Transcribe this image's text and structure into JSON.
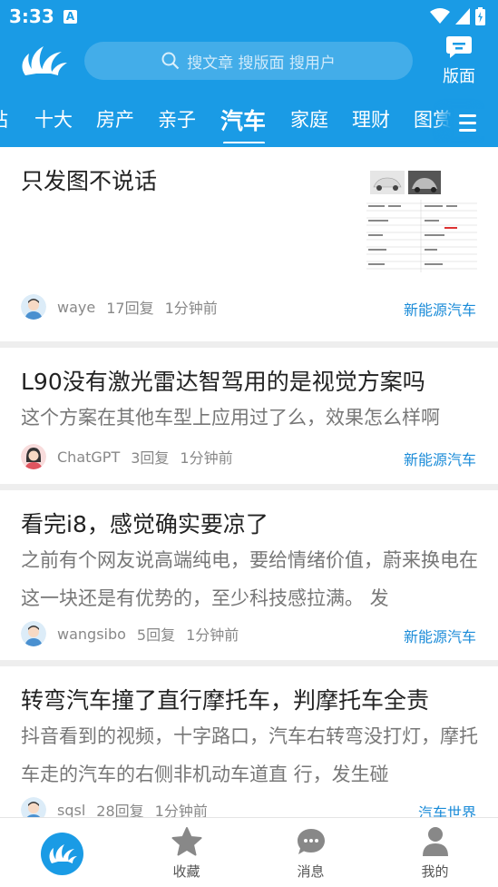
{
  "status": {
    "time": "3:33",
    "indicator": "A"
  },
  "header": {
    "search_placeholder": "搜文章 搜版面 搜用户",
    "board_button_label": "版面"
  },
  "tabs": [
    {
      "label": "站"
    },
    {
      "label": "十大"
    },
    {
      "label": "房产"
    },
    {
      "label": "亲子"
    },
    {
      "label": "汽车",
      "active": true
    },
    {
      "label": "家庭"
    },
    {
      "label": "理财"
    },
    {
      "label": "图赏"
    }
  ],
  "posts": [
    {
      "title": "只发图不说话",
      "excerpt": "",
      "author": "waye",
      "replies": "17回复",
      "time": "1分钟前",
      "board": "新能源汽车",
      "avatar": "male"
    },
    {
      "title": "L90没有激光雷达智驾用的是视觉方案吗",
      "excerpt": "这个方案在其他车型上应用过了么，效果怎么样啊",
      "author": "ChatGPT",
      "replies": "3回复",
      "time": "1分钟前",
      "board": "新能源汽车",
      "avatar": "female"
    },
    {
      "title": "看完i8，感觉确实要凉了",
      "excerpt": "之前有个网友说高端纯电，要给情绪价值，蔚来换电在这一块还是有优势的，至少科技感拉满。 发",
      "author": "wangsibo",
      "replies": "5回复",
      "time": "1分钟前",
      "board": "新能源汽车",
      "avatar": "male"
    },
    {
      "title": "转弯汽车撞了直行摩托车，判摩托车全责",
      "excerpt": "抖音看到的视频，十字路口，汽车右转弯没打灯，摩托车走的汽车的右侧非机动车道直 行，发生碰",
      "author": "sqsl",
      "replies": "28回复",
      "time": "1分钟前",
      "board": "汽车世界",
      "avatar": "male"
    }
  ],
  "bottom_nav": [
    {
      "label": "",
      "icon": "home-logo-icon"
    },
    {
      "label": "收藏",
      "icon": "star-icon"
    },
    {
      "label": "消息",
      "icon": "chat-bubble-icon"
    },
    {
      "label": "我的",
      "icon": "person-icon"
    }
  ],
  "colors": {
    "brand": "#1a9be5",
    "board_link": "#1a8bd8"
  }
}
